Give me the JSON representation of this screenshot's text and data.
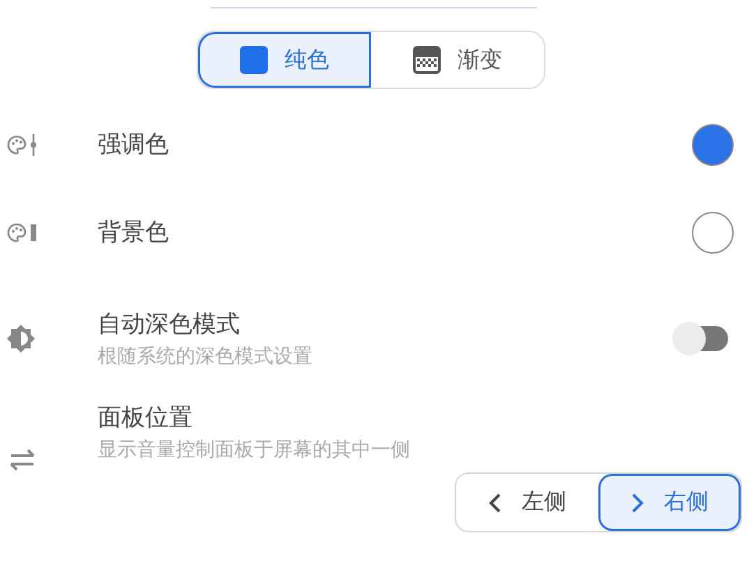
{
  "fill_mode": [
    {
      "label": "纯色",
      "selected": true
    },
    {
      "label": "渐变",
      "selected": false
    }
  ],
  "settings": [
    {
      "kind": "color",
      "title": "强调色",
      "color": "#2a72e5"
    },
    {
      "kind": "color",
      "title": "背景色",
      "color": "#ffffff"
    },
    {
      "kind": "toggle",
      "title": "自动深色模式",
      "subtitle": "根随系统的深色模式设置",
      "on": false
    },
    {
      "kind": "position",
      "title": "面板位置",
      "subtitle": "显示音量控制面板于屏幕的其中一侧",
      "options": [
        {
          "label": "左侧",
          "selected": false
        },
        {
          "label": "右侧",
          "selected": true
        }
      ]
    }
  ]
}
